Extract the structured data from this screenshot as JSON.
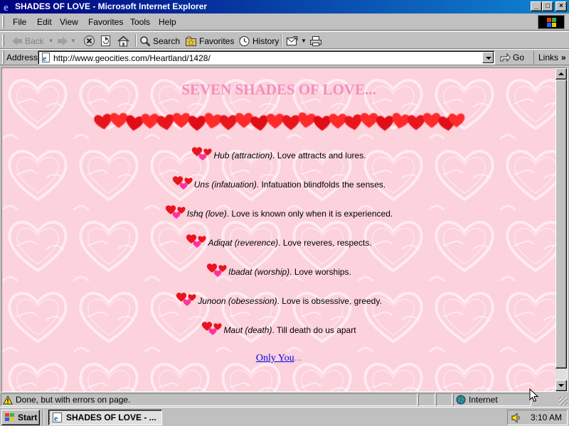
{
  "window": {
    "title": "SHADES OF LOVE - Microsoft Internet Explorer",
    "controls": {
      "minimize": "_",
      "maximize": "□",
      "close": "×"
    }
  },
  "menu": [
    "File",
    "Edit",
    "View",
    "Favorites",
    "Tools",
    "Help"
  ],
  "toolbar": {
    "back": "Back",
    "search": "Search",
    "favorites": "Favorites",
    "history": "History"
  },
  "address": {
    "label": "Address",
    "url": "http://www.geocities.com/Heartland/1428/",
    "go": "Go",
    "links": "Links"
  },
  "page": {
    "title": "SEVEN SHADES OF LOVE...",
    "lines": [
      {
        "term": "Hub (attraction)",
        "text": ". Love attracts and lures."
      },
      {
        "term": "Uns (infatuation)",
        "text": ". Infatuation blindfolds the senses."
      },
      {
        "term": "Ishq (love)",
        "text": ". Love is known only when it is experienced."
      },
      {
        "term": "Adiqat (reverence)",
        "text": ". Love reveres, respects."
      },
      {
        "term": "Ibadat (worship)",
        "text": ". Love worships."
      },
      {
        "term": "Junoon (obesession)",
        "text": ". Love is obsessive, greedy."
      },
      {
        "term": "Maut (death)",
        "text": ". Till death do us apart"
      }
    ],
    "link": "Only You",
    "link_suffix": "...",
    "colors": {
      "background": "#fcd2dc",
      "title": "#f58cbe",
      "heart_red": "#ee1111",
      "heart_pink": "#ff3399"
    }
  },
  "status": {
    "text": "Done, but with errors on page.",
    "zone": "Internet"
  },
  "taskbar": {
    "start": "Start",
    "task": "SHADES OF LOVE - ...",
    "time": "3:10 AM"
  },
  "icons": [
    "ie-icon",
    "windows-flag-icon",
    "back-arrow-icon",
    "forward-arrow-icon",
    "stop-icon",
    "refresh-icon",
    "home-icon",
    "search-icon",
    "favorites-icon",
    "history-icon",
    "mail-icon",
    "print-icon",
    "page-icon",
    "go-arrow-icon",
    "warning-icon",
    "globe-icon",
    "speaker-icon",
    "hearts-icon"
  ]
}
